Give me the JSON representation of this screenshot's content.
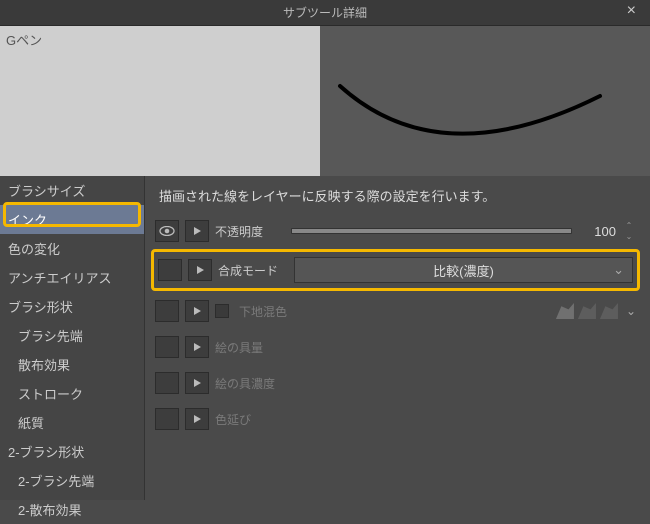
{
  "window": {
    "title": "サブツール詳細"
  },
  "tool": {
    "name": "Gペン"
  },
  "sidebar": {
    "items": [
      {
        "label": "ブラシサイズ",
        "sub": false,
        "selected": false
      },
      {
        "label": "インク",
        "sub": false,
        "selected": true
      },
      {
        "label": "色の変化",
        "sub": false,
        "selected": false
      },
      {
        "label": "アンチエイリアス",
        "sub": false,
        "selected": false
      },
      {
        "label": "ブラシ形状",
        "sub": false,
        "selected": false
      },
      {
        "label": "ブラシ先端",
        "sub": true,
        "selected": false
      },
      {
        "label": "散布効果",
        "sub": true,
        "selected": false
      },
      {
        "label": "ストローク",
        "sub": true,
        "selected": false
      },
      {
        "label": "紙質",
        "sub": true,
        "selected": false
      },
      {
        "label": "2-ブラシ形状",
        "sub": false,
        "selected": false
      },
      {
        "label": "2-ブラシ先端",
        "sub": true,
        "selected": false
      },
      {
        "label": "2-散布効果",
        "sub": true,
        "selected": false
      }
    ]
  },
  "description": "描画された線をレイヤーに反映する際の設定を行います。",
  "props": {
    "opacity": {
      "label": "不透明度",
      "value": "100"
    },
    "blend": {
      "label": "合成モード",
      "selected": "比較(濃度)"
    },
    "underlying": {
      "label": "下地混色"
    },
    "amount": {
      "label": "絵の具量"
    },
    "density": {
      "label": "絵の具濃度"
    },
    "spread": {
      "label": "色延び"
    }
  }
}
